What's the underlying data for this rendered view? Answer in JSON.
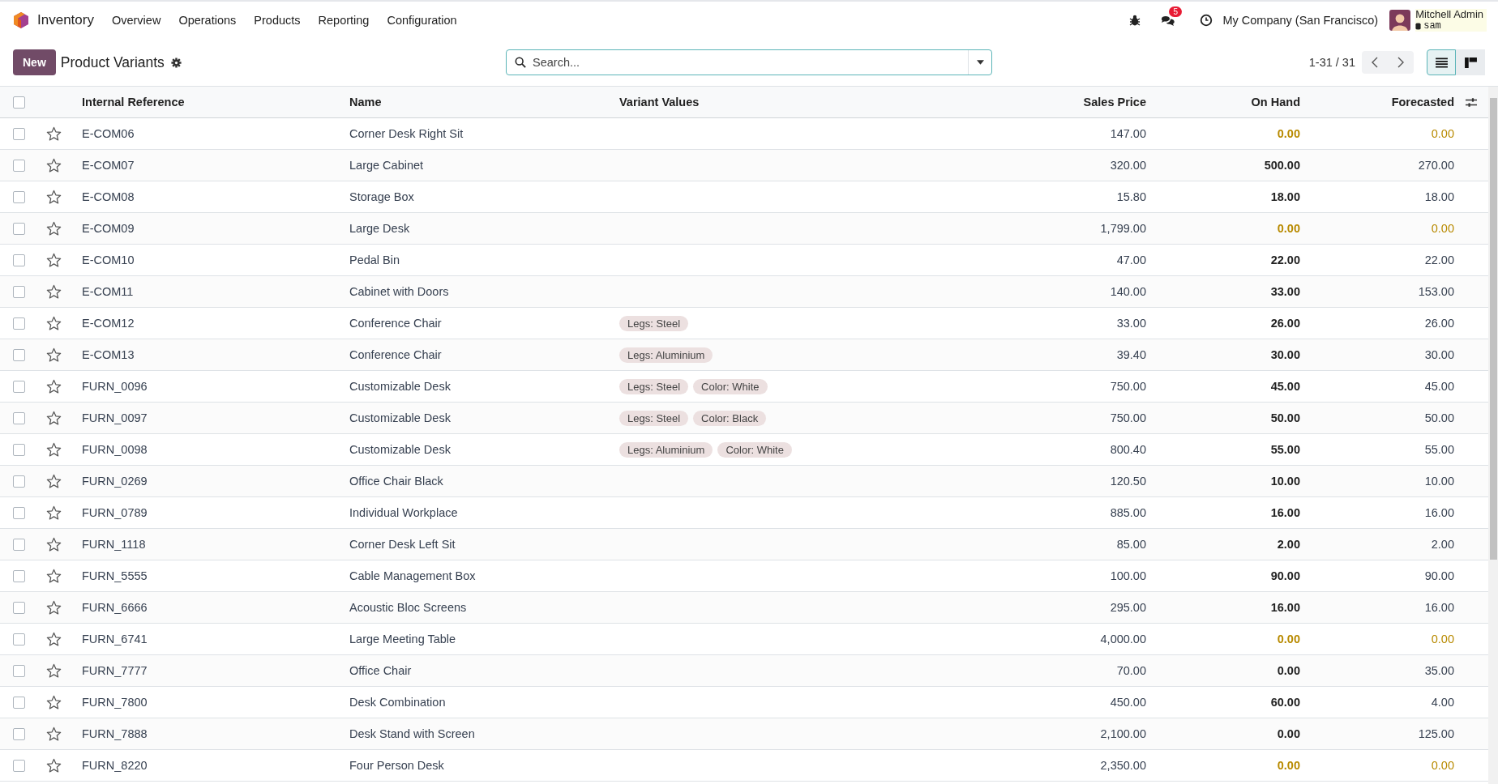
{
  "navbar": {
    "app_name": "Inventory",
    "menu": [
      "Overview",
      "Operations",
      "Products",
      "Reporting",
      "Configuration"
    ],
    "messages_badge": "5",
    "company": "My Company (San Francisco)",
    "user": "Mitchell Admin",
    "database": "sam"
  },
  "control_panel": {
    "new_button": "New",
    "title": "Product Variants",
    "search": {
      "placeholder": "Search..."
    },
    "pager": "1-31 / 31",
    "views": [
      {
        "kind": "list",
        "selected": true
      },
      {
        "kind": "kanban",
        "selected": false
      }
    ]
  },
  "table": {
    "columns": [
      "Internal Reference",
      "Name",
      "Variant Values",
      "Sales Price",
      "On Hand",
      "Forecasted"
    ],
    "all_checked": false,
    "rows": [
      {
        "ref": "E-COM06",
        "name": "Corner Desk Right Sit",
        "variants": [],
        "price": "147.00",
        "on_hand": "0.00",
        "forecasted": "0.00",
        "warning": true,
        "checked": false
      },
      {
        "ref": "E-COM07",
        "name": "Large Cabinet",
        "variants": [],
        "price": "320.00",
        "on_hand": "500.00",
        "forecasted": "270.00",
        "warning": false,
        "checked": false
      },
      {
        "ref": "E-COM08",
        "name": "Storage Box",
        "variants": [],
        "price": "15.80",
        "on_hand": "18.00",
        "forecasted": "18.00",
        "warning": false,
        "checked": false
      },
      {
        "ref": "E-COM09",
        "name": "Large Desk",
        "variants": [],
        "price": "1,799.00",
        "on_hand": "0.00",
        "forecasted": "0.00",
        "warning": true,
        "checked": false
      },
      {
        "ref": "E-COM10",
        "name": "Pedal Bin",
        "variants": [],
        "price": "47.00",
        "on_hand": "22.00",
        "forecasted": "22.00",
        "warning": false,
        "checked": false
      },
      {
        "ref": "E-COM11",
        "name": "Cabinet with Doors",
        "variants": [],
        "price": "140.00",
        "on_hand": "33.00",
        "forecasted": "153.00",
        "warning": false,
        "checked": false
      },
      {
        "ref": "E-COM12",
        "name": "Conference Chair",
        "variants": [
          "Legs: Steel"
        ],
        "price": "33.00",
        "on_hand": "26.00",
        "forecasted": "26.00",
        "warning": false,
        "checked": false
      },
      {
        "ref": "E-COM13",
        "name": "Conference Chair",
        "variants": [
          "Legs: Aluminium"
        ],
        "price": "39.40",
        "on_hand": "30.00",
        "forecasted": "30.00",
        "warning": false,
        "checked": false
      },
      {
        "ref": "FURN_0096",
        "name": "Customizable Desk",
        "variants": [
          "Legs: Steel",
          "Color: White"
        ],
        "price": "750.00",
        "on_hand": "45.00",
        "forecasted": "45.00",
        "warning": false,
        "checked": false
      },
      {
        "ref": "FURN_0097",
        "name": "Customizable Desk",
        "variants": [
          "Legs: Steel",
          "Color: Black"
        ],
        "price": "750.00",
        "on_hand": "50.00",
        "forecasted": "50.00",
        "warning": false,
        "checked": false
      },
      {
        "ref": "FURN_0098",
        "name": "Customizable Desk",
        "variants": [
          "Legs: Aluminium",
          "Color: White"
        ],
        "price": "800.40",
        "on_hand": "55.00",
        "forecasted": "55.00",
        "warning": false,
        "checked": false
      },
      {
        "ref": "FURN_0269",
        "name": "Office Chair Black",
        "variants": [],
        "price": "120.50",
        "on_hand": "10.00",
        "forecasted": "10.00",
        "warning": false,
        "checked": false
      },
      {
        "ref": "FURN_0789",
        "name": "Individual Workplace",
        "variants": [],
        "price": "885.00",
        "on_hand": "16.00",
        "forecasted": "16.00",
        "warning": false,
        "checked": false
      },
      {
        "ref": "FURN_1118",
        "name": "Corner Desk Left Sit",
        "variants": [],
        "price": "85.00",
        "on_hand": "2.00",
        "forecasted": "2.00",
        "warning": false,
        "checked": false
      },
      {
        "ref": "FURN_5555",
        "name": "Cable Management Box",
        "variants": [],
        "price": "100.00",
        "on_hand": "90.00",
        "forecasted": "90.00",
        "warning": false,
        "checked": false
      },
      {
        "ref": "FURN_6666",
        "name": "Acoustic Bloc Screens",
        "variants": [],
        "price": "295.00",
        "on_hand": "16.00",
        "forecasted": "16.00",
        "warning": false,
        "checked": false
      },
      {
        "ref": "FURN_6741",
        "name": "Large Meeting Table",
        "variants": [],
        "price": "4,000.00",
        "on_hand": "0.00",
        "forecasted": "0.00",
        "warning": true,
        "checked": false
      },
      {
        "ref": "FURN_7777",
        "name": "Office Chair",
        "variants": [],
        "price": "70.00",
        "on_hand": "0.00",
        "forecasted": "35.00",
        "warning": false,
        "checked": false
      },
      {
        "ref": "FURN_7800",
        "name": "Desk Combination",
        "variants": [],
        "price": "450.00",
        "on_hand": "60.00",
        "forecasted": "4.00",
        "warning": false,
        "checked": false
      },
      {
        "ref": "FURN_7888",
        "name": "Desk Stand with Screen",
        "variants": [],
        "price": "2,100.00",
        "on_hand": "0.00",
        "forecasted": "125.00",
        "warning": false,
        "checked": false
      },
      {
        "ref": "FURN_8220",
        "name": "Four Person Desk",
        "variants": [],
        "price": "2,350.00",
        "on_hand": "0.00",
        "forecasted": "0.00",
        "warning": true,
        "checked": false
      }
    ]
  }
}
